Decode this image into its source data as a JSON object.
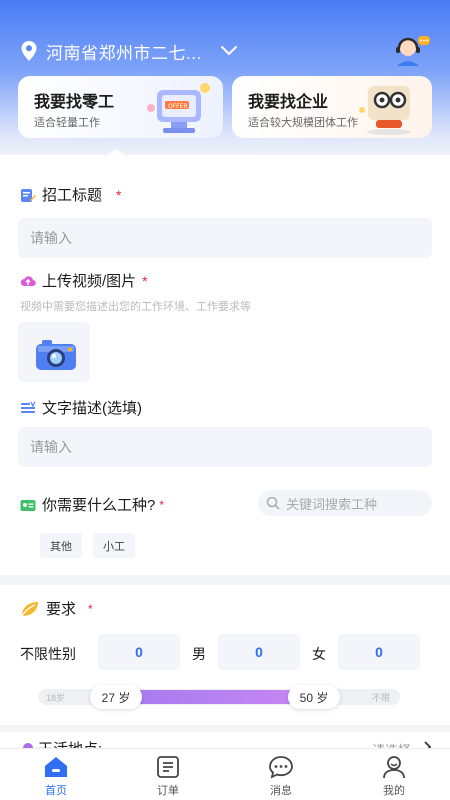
{
  "header": {
    "location": "河南省郑州市二七...",
    "accent": "#2f6ff0"
  },
  "cards": [
    {
      "title": "我要找零工",
      "subtitle": "适合轻量工作"
    },
    {
      "title": "我要找企业",
      "subtitle": "适合较大规模团体工作"
    }
  ],
  "form": {
    "title_label": "招工标题",
    "title_placeholder": "请输入",
    "upload_label": "上传视频/图片",
    "upload_hint": "视频中需要您描述出您的工作环境、工作要求等",
    "desc_label": "文字描述(选填)",
    "desc_placeholder": "请输入",
    "type_label": "你需要什么工种?",
    "type_search_placeholder": "关键词搜索工种",
    "type_chips": [
      "其他",
      "小工"
    ],
    "required_mark": "*"
  },
  "requirements": {
    "label": "要求",
    "gender_any_label": "不限性别",
    "gender_any_value": "0",
    "male_label": "男",
    "male_value": "0",
    "female_label": "女",
    "female_value": "0",
    "age_min_label": "18岁",
    "age_max_label": "不限",
    "age_low": "27 岁",
    "age_high": "50 岁"
  },
  "location_section": {
    "label": "干活地点:",
    "pick": "请选择"
  },
  "tabs": [
    {
      "label": "首页",
      "icon": "home-icon",
      "active": true
    },
    {
      "label": "订单",
      "icon": "order-icon",
      "active": false
    },
    {
      "label": "消息",
      "icon": "message-icon",
      "active": false
    },
    {
      "label": "我的",
      "icon": "profile-icon",
      "active": false
    }
  ]
}
